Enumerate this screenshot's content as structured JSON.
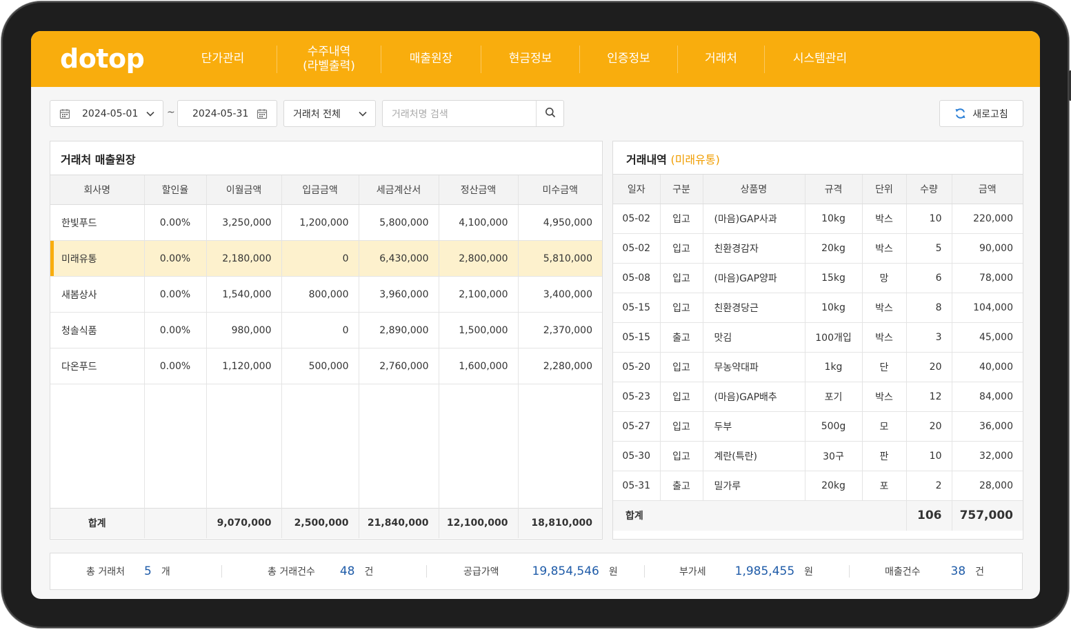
{
  "app": {
    "logo": "dotop"
  },
  "nav": [
    {
      "label": "단가관리"
    },
    {
      "label": "수주내역\n(라벨출력)"
    },
    {
      "label": "매출원장"
    },
    {
      "label": "현금정보"
    },
    {
      "label": "인증정보"
    },
    {
      "label": "거래처"
    },
    {
      "label": "시스템관리"
    }
  ],
  "filters": {
    "start_date": "2024-05-01",
    "tilde": "~",
    "end_date": "2024-05-31",
    "partner_select": "거래처 전체",
    "search_placeholder": "거래처명 검색",
    "refresh_label": "새로고침"
  },
  "ledger": {
    "title": "거래처 매출원장",
    "columns": [
      "회사명",
      "할인율",
      "이월금액",
      "입금금액",
      "세금계산서",
      "정산금액",
      "미수금액"
    ],
    "rows": [
      [
        "한빛푸드",
        "0.00%",
        "3,250,000",
        "1,200,000",
        "5,800,000",
        "4,100,000",
        "4,950,000"
      ],
      [
        "미래유통",
        "0.00%",
        "2,180,000",
        "0",
        "6,430,000",
        "2,800,000",
        "5,810,000"
      ],
      [
        "새봄상사",
        "0.00%",
        "1,540,000",
        "800,000",
        "3,960,000",
        "2,100,000",
        "3,400,000"
      ],
      [
        "청솔식품",
        "0.00%",
        "980,000",
        "0",
        "2,890,000",
        "1,500,000",
        "2,370,000"
      ],
      [
        "다온푸드",
        "0.00%",
        "1,120,000",
        "500,000",
        "2,760,000",
        "1,600,000",
        "2,280,000"
      ]
    ],
    "selected_row": 1,
    "total": [
      "합계",
      "",
      "9,070,000",
      "2,500,000",
      "21,840,000",
      "12,100,000",
      "18,810,000"
    ]
  },
  "detail": {
    "title": "거래내역",
    "subtitle": "(미래유통)",
    "columns": [
      "일자",
      "구분",
      "상품명",
      "규격",
      "단위",
      "수량",
      "금액"
    ],
    "rows": [
      [
        "05-02",
        "입고",
        "(마음)GAP사과",
        "10kg",
        "박스",
        "10",
        "220,000"
      ],
      [
        "05-02",
        "입고",
        "친환경감자",
        "20kg",
        "박스",
        "5",
        "90,000"
      ],
      [
        "05-08",
        "입고",
        "(마음)GAP양파",
        "15kg",
        "망",
        "6",
        "78,000"
      ],
      [
        "05-15",
        "입고",
        "친환경당근",
        "10kg",
        "박스",
        "8",
        "104,000"
      ],
      [
        "05-15",
        "출고",
        "맛김",
        "100개입",
        "박스",
        "3",
        "45,000"
      ],
      [
        "05-20",
        "입고",
        "무농약대파",
        "1kg",
        "단",
        "20",
        "40,000"
      ],
      [
        "05-23",
        "입고",
        "(마음)GAP배추",
        "포기",
        "박스",
        "12",
        "84,000"
      ],
      [
        "05-27",
        "입고",
        "두부",
        "500g",
        "모",
        "20",
        "36,000"
      ],
      [
        "05-30",
        "입고",
        "계란(특란)",
        "30구",
        "판",
        "10",
        "32,000"
      ],
      [
        "05-31",
        "출고",
        "밀가루",
        "20kg",
        "포",
        "2",
        "28,000"
      ]
    ],
    "total_label": "합계",
    "total_qty": "106",
    "total_amount": "757,000"
  },
  "summary": [
    {
      "label": "총 거래처",
      "value": "5",
      "unit": "개"
    },
    {
      "label": "총 거래건수",
      "value": "48",
      "unit": "건"
    },
    {
      "label": "공급가액",
      "value": "19,854,546",
      "unit": "원"
    },
    {
      "label": "부가세",
      "value": "1,985,455",
      "unit": "원"
    },
    {
      "label": "매출건수",
      "value": "38",
      "unit": "건"
    }
  ],
  "colors": {
    "accent": "#f9ad0d",
    "selected_row": "#fdf1cd",
    "value_blue": "#1e5ba8",
    "subtitle_orange": "#f09d00"
  },
  "icons": {
    "date": "calendar-icon",
    "select": "chevron-down-icon",
    "search": "search-icon",
    "refresh": "refresh-icon"
  }
}
